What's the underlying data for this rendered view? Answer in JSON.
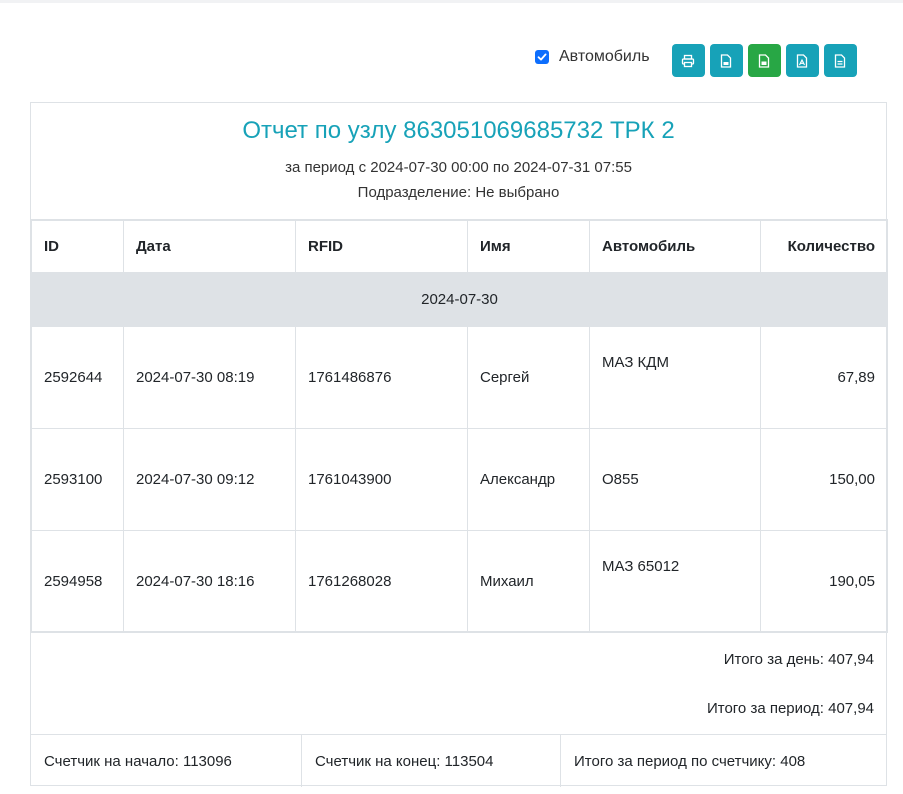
{
  "toolbar": {
    "checkbox_label": "Автомобиль",
    "checkbox_checked": true,
    "buttons": [
      {
        "icon": "printer-icon",
        "color": "#17a2b8"
      },
      {
        "icon": "file-icon",
        "color": "#17a2b8"
      },
      {
        "icon": "excel-file-icon",
        "color": "#28a745"
      },
      {
        "icon": "pdf-file-icon",
        "color": "#17a2b8"
      },
      {
        "icon": "text-file-icon",
        "color": "#17a2b8"
      }
    ]
  },
  "report": {
    "title": "Отчет по узлу 863051069685732 ТРК 2",
    "period": "за период с 2024-07-30 00:00 по 2024-07-31 07:55",
    "division": "Подразделение: Не выбрано",
    "columns": [
      "ID",
      "Дата",
      "RFID",
      "Имя",
      "Автомобиль",
      "Количество"
    ],
    "group_date": "2024-07-30",
    "rows": [
      {
        "id": "2592644",
        "date": "2024-07-30 08:19",
        "rfid": "1761486876",
        "name": "Сергей",
        "car": "МАЗ КДМ",
        "qty": "67,89"
      },
      {
        "id": "2593100",
        "date": "2024-07-30 09:12",
        "rfid": "1761043900",
        "name": "Александр",
        "car": "О855",
        "qty": "150,00"
      },
      {
        "id": "2594958",
        "date": "2024-07-30 18:16",
        "rfid": "1761268028",
        "name": "Михаил",
        "car": "МАЗ 65012",
        "qty": "190,05"
      }
    ],
    "total_day": "Итого за день: 407,94",
    "total_period": "Итого за период: 407,94",
    "counter_start": "Счетчик на начало: 113096",
    "counter_end": "Счетчик на конец: 113504",
    "counter_total": "Итого за период по счетчику: 408"
  },
  "colors": {
    "accent": "#17a2b8",
    "success": "#28a745",
    "checkbox": "#0d6efd",
    "group_row": "#dee2e6"
  }
}
